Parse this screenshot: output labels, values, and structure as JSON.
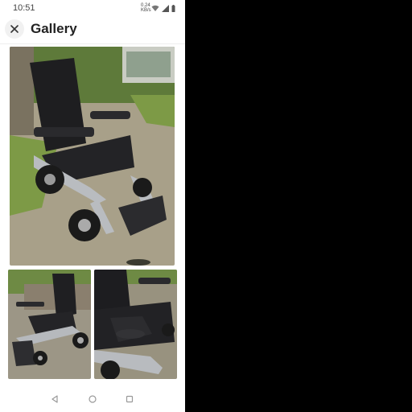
{
  "status_bar": {
    "time": "10:51",
    "data_indicator": "0.24 KB/s"
  },
  "header": {
    "title": "Gallery",
    "close_icon": "close-icon"
  },
  "gallery": {
    "photos": [
      {
        "subject": "power-wheelchair"
      },
      {
        "subject": "power-wheelchair"
      },
      {
        "subject": "power-wheelchair"
      }
    ]
  },
  "nav_bar": {
    "back_icon": "back-triangle-icon",
    "home_icon": "home-circle-icon",
    "recents_icon": "recents-square-icon"
  },
  "colors": {
    "background": "#000000",
    "screen": "#ffffff",
    "title_text": "#222222"
  }
}
